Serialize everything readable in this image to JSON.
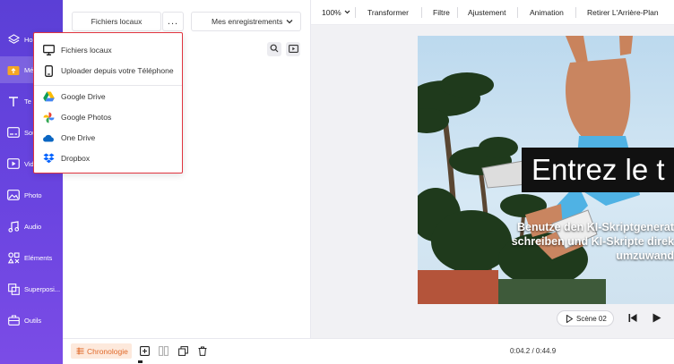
{
  "sidebar": {
    "items": [
      {
        "label": "Ho",
        "icon": "layers-icon"
      },
      {
        "label": "Mé",
        "icon": "folder-upload-icon",
        "active": true
      },
      {
        "label": "Te",
        "icon": "text-icon"
      },
      {
        "label": "Sou",
        "icon": "subtitles-icon"
      },
      {
        "label": "Vid",
        "icon": "video-icon"
      },
      {
        "label": "Photo",
        "icon": "photo-icon"
      },
      {
        "label": "Audio",
        "icon": "audio-icon"
      },
      {
        "label": "Eléments",
        "icon": "elements-icon"
      },
      {
        "label": "Superposi...",
        "icon": "overlay-icon"
      },
      {
        "label": "Outils",
        "icon": "toolbox-icon"
      }
    ],
    "accent_color": "#6a44e0"
  },
  "panel": {
    "local_files_label": "Fichiers locaux",
    "more_label": "...",
    "recordings_label": "Mes enregistrements"
  },
  "upload_menu": {
    "items": [
      {
        "label": "Fichiers locaux",
        "icon": "monitor-icon"
      },
      {
        "label": "Uploader depuis votre Téléphone",
        "icon": "phone-icon"
      },
      {
        "label": "Google Drive",
        "icon": "google-drive-icon"
      },
      {
        "label": "Google Photos",
        "icon": "google-photos-icon"
      },
      {
        "label": "One Drive",
        "icon": "onedrive-icon"
      },
      {
        "label": "Dropbox",
        "icon": "dropbox-icon"
      }
    ],
    "highlight_color": "#e0343f"
  },
  "toolbar": {
    "zoom": "100%",
    "items": [
      "Transformer",
      "Filtre",
      "Ajustement",
      "Animation",
      "Retirer L'Arrière-Plan"
    ]
  },
  "canvas": {
    "title_text": "Entrez le t",
    "subtitle_text": "Benutze den KI-Skriptgenerat schreiben und KI-Skripte direk umzuwand"
  },
  "playback": {
    "scene_label": "Scène 02"
  },
  "timeline": {
    "chrono_label": "Chronologie",
    "time": "0:04.2 / 0:44.9",
    "chrono_color": "#e06a2a"
  }
}
